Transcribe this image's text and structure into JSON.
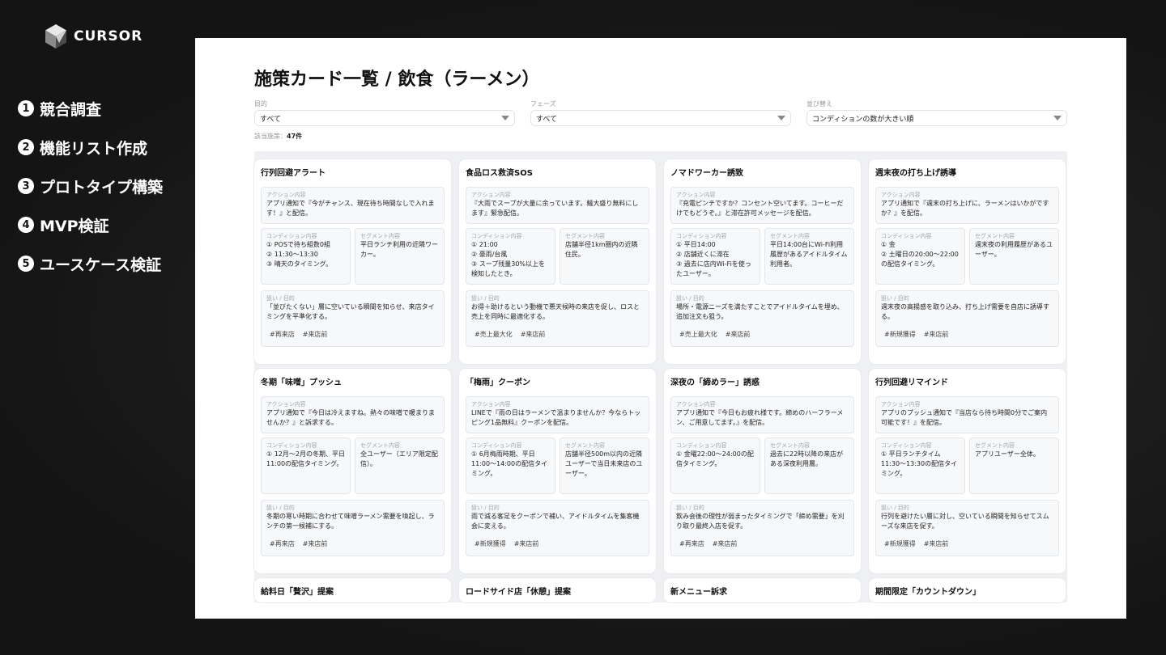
{
  "brand": {
    "name": "CURSOR",
    "icon": "cursor-cube-icon"
  },
  "steps": [
    {
      "num": "1",
      "label": "競合調査"
    },
    {
      "num": "2",
      "label": "機能リスト作成"
    },
    {
      "num": "3",
      "label": "プロトタイプ構築"
    },
    {
      "num": "4",
      "label": "MVP検証"
    },
    {
      "num": "5",
      "label": "ユースケース検証"
    }
  ],
  "app": {
    "title": "施策カード一覧 / 飲食（ラーメン）",
    "filters": [
      {
        "label": "目的",
        "value": "すべて"
      },
      {
        "label": "フェーズ",
        "value": "すべて"
      },
      {
        "label": "並び替え",
        "value": "コンディションの数が大きい順"
      }
    ],
    "count_label": "該当施策：",
    "count_value": "47件",
    "field_labels": {
      "action": "アクション内容",
      "condition": "コンディション内容",
      "segment": "セグメント内容",
      "aim": "狙い / 目的"
    },
    "cards": [
      {
        "title": "行列回避アラート",
        "action": "アプリ通知で『今がチャンス、現在待ち時間なしで入れます！』と配信。",
        "condition": "① POSで待ち組数0組\n② 11:30〜13:30\n③ 晴天のタイミング。",
        "segment": "平日ランチ利用の近隣ワーカー。",
        "aim": "「並びたくない」層に空いている瞬間を知らせ、来店タイミングを平準化する。",
        "tags": [
          "#再来店",
          "#来店前"
        ]
      },
      {
        "title": "食品ロス救済SOS",
        "action": "『大雨でスープが大量に余っています。麺大盛り無料にします』緊急配信。",
        "condition": "① 21:00\n② 豪雨/台風\n③ スープ残量30%以上を検知したとき。",
        "segment": "店舗半径1km圏内の近隣住民。",
        "aim": "お得＋助けるという動機で悪天候時の来店を促し、ロスと売上を同時に最適化する。",
        "tags": [
          "#売上最大化",
          "#来店前"
        ]
      },
      {
        "title": "ノマドワーカー誘致",
        "action": "『充電ピンチですか？コンセント空いてます。コーヒーだけでもどうぞ。』と滞在許可メッセージを配信。",
        "condition": "① 平日14:00\n② 店舗近くに滞在\n③ 過去に店内Wi-Fiを使ったユーザー。",
        "segment": "平日14:00台にWi-Fi利用履歴があるアイドルタイム利用者。",
        "aim": "場所・電源ニーズを満たすことでアイドルタイムを埋め、追加注文も狙う。",
        "tags": [
          "#売上最大化",
          "#来店前"
        ]
      },
      {
        "title": "週末夜の打ち上げ誘導",
        "action": "アプリ通知で『週末の打ち上げに、ラーメンはいかがですか？』を配信。",
        "condition": "① 金\n② 土曜日の20:00〜22:00の配信タイミング。",
        "segment": "週末夜の利用履歴があるユーザー。",
        "aim": "週末夜の高揚感を取り込み、打ち上げ需要を自店に誘導する。",
        "tags": [
          "#新規獲得",
          "#来店前"
        ]
      },
      {
        "title": "冬期「味噌」プッシュ",
        "action": "アプリ通知で『今日は冷えますね。熱々の味噌で暖まりませんか？』と訴求する。",
        "condition": "① 12月〜2月の冬期、平日11:00の配信タイミング。",
        "segment": "全ユーザー（エリア限定配信）。",
        "aim": "冬期の寒い時期に合わせて味噌ラーメン需要を喚起し、ランチの第一候補にする。",
        "tags": [
          "#再来店",
          "#来店前"
        ]
      },
      {
        "title": "「梅雨」クーポン",
        "action": "LINEで『雨の日はラーメンで温まりませんか？今ならトッピング1品無料』クーポンを配信。",
        "condition": "① 6月梅雨時期、平日11:00〜14:00の配信タイミング。",
        "segment": "店舗半径500m以内の近隣ユーザーで当日未来店のユーザー。",
        "aim": "雨で減る客足をクーポンで補い、アイドルタイムを集客機会に変える。",
        "tags": [
          "#新規獲得",
          "#来店前"
        ]
      },
      {
        "title": "深夜の「締めラー」誘惑",
        "action": "アプリ通知で『今日もお疲れ様です。締めのハーフラーメン、ご用意してます。』を配信。",
        "condition": "① 金曜22:00〜24:00の配信タイミング。",
        "segment": "過去に22時以降の来店がある深夜利用層。",
        "aim": "飲み会後の理性が弱まったタイミングで「締め需要」を刈り取り最終入店を促す。",
        "tags": [
          "#再来店",
          "#来店前"
        ]
      },
      {
        "title": "行列回避リマインド",
        "action": "アプリのプッシュ通知で『当店なら待ち時間0分でご案内可能です！』を配信。",
        "condition": "① 平日ランチタイム11:30〜13:30の配信タイミング。",
        "segment": "アプリユーザー全体。",
        "aim": "行列を避けたい層に対し、空いている瞬間を知らせてスムーズな来店を促す。",
        "tags": [
          "#新規獲得",
          "#来店前"
        ]
      }
    ],
    "partial_cards": [
      "給料日「贅沢」提案",
      "ロードサイド店「休憩」提案",
      "新メニュー訴求",
      "期間限定「カウントダウン」"
    ]
  }
}
